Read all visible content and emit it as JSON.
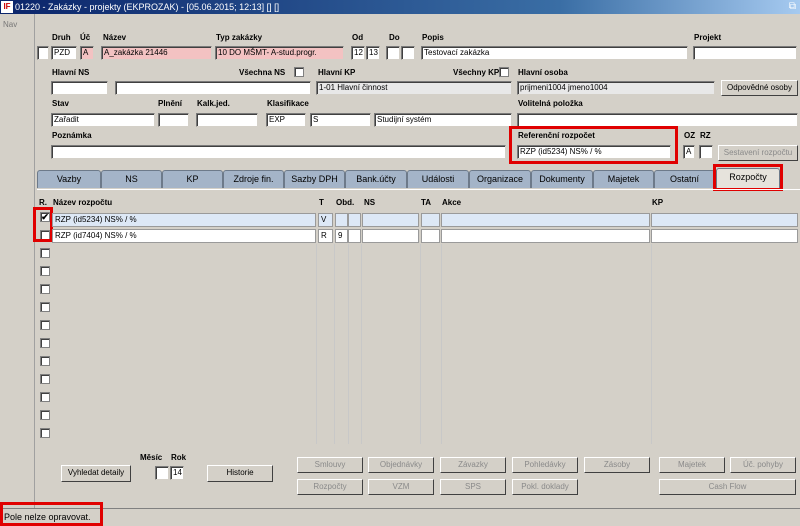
{
  "window": {
    "title": "01220 - Zakázky - projekty (EKPROZAK) - [05.06.2015; 12:13] [] []",
    "logo": "IF"
  },
  "nav": {
    "label": "Nav"
  },
  "header": {
    "druh": {
      "label": "Druh",
      "value": "PZD"
    },
    "uc": {
      "label": "Úč",
      "value": "A"
    },
    "nazev": {
      "label": "Název",
      "value": "A_zakázka 21446"
    },
    "typ": {
      "label": "Typ zakázky",
      "value": "10 DO MŠMT- A-stud.progr."
    },
    "od": {
      "label": "Od",
      "value1": "12",
      "value2": "13"
    },
    "do": {
      "label": "Do"
    },
    "popis": {
      "label": "Popis",
      "value": "Testovací zakázka"
    },
    "projekt": {
      "label": "Projekt",
      "value": ""
    },
    "hlavni_ns": {
      "label": "Hlavní NS"
    },
    "vsechna_ns": {
      "label": "Všechna NS"
    },
    "hlavni_kp": {
      "label": "Hlavní KP",
      "value": "1-01 Hlavní činnost"
    },
    "vsechny_kp": {
      "label": "Všechny KP"
    },
    "hlavni_osoba": {
      "label": "Hlavní osoba",
      "value": "prijmeni1004 jmeno1004"
    },
    "odpovedne_osoby": "Odpovědné osoby",
    "stav": {
      "label": "Stav",
      "value": "Zařadit"
    },
    "plneni": {
      "label": "Plnění"
    },
    "kalk": {
      "label": "Kalk.jed."
    },
    "klasifikace": {
      "label": "Klasifikace",
      "v1": "EXP",
      "v2": "S",
      "v3": "Studijní systém"
    },
    "volitelna": {
      "label": "Volitelná položka"
    },
    "poznamka": {
      "label": "Poznámka"
    },
    "ref_rozpocet": {
      "label": "Referenční rozpočet",
      "value": "RZP (id5234) NS% / %"
    },
    "oz": {
      "label": "OZ",
      "value": "A"
    },
    "rz": {
      "label": "RZ"
    },
    "sestaveni": "Sestavení rozpočtu"
  },
  "tabs": [
    "Vazby",
    "NS",
    "KP",
    "Zdroje fin.",
    "Sazby DPH",
    "Bank.účty",
    "Události",
    "Organizace",
    "Dokumenty",
    "Majetek",
    "Ostatní",
    "Rozpočty"
  ],
  "grid": {
    "columns": [
      "R.",
      "Název rozpočtu",
      "T",
      "Obd.",
      "NS",
      "TA",
      "Akce",
      "KP"
    ],
    "rows": [
      {
        "checked": true,
        "name": "RZP (id5234) NS% / %",
        "t": "V",
        "obd": ""
      },
      {
        "checked": false,
        "name": "RZP (id7404) NS% / %",
        "t": "R",
        "obd": "9"
      }
    ]
  },
  "footer": {
    "vyhledat": "Vyhledat detaily",
    "mesic": "Měsíc",
    "rok": {
      "label": "Rok",
      "value": "14"
    },
    "historie": "Historie",
    "buttons_row1": [
      "Smlouvy",
      "Objednávky",
      "Závazky",
      "Pohledávky",
      "Zásoby",
      "Majetek",
      "Úč. pohyby"
    ],
    "buttons_row2": [
      "Rozpočty",
      "VZM",
      "SPS",
      "Pokl. doklady",
      "Cash Flow"
    ]
  },
  "status": {
    "message": "Pole nelze opravovat."
  },
  "colors": {
    "highlight": "#e00000",
    "title_bar": "#0a246a",
    "selected_row": "#dde8f6"
  }
}
